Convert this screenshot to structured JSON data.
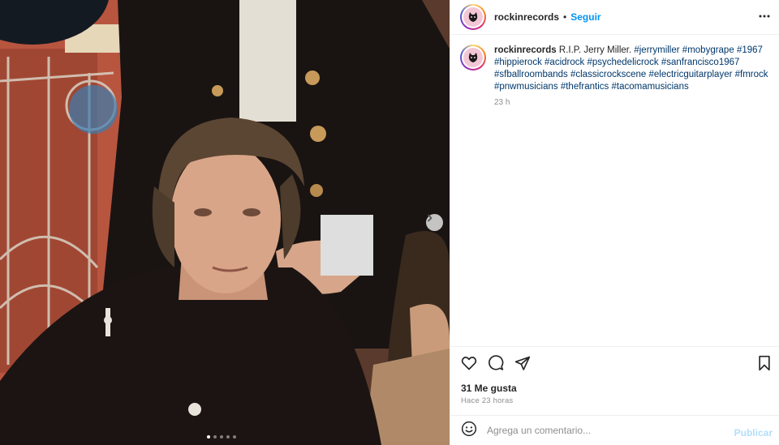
{
  "post": {
    "username": "rockinrecords",
    "follow_label": "Seguir",
    "separator": "•",
    "caption_text": "R.I.P. Jerry Miller.",
    "hashtags": [
      "#jerrymiller",
      "#mobygrape",
      "#1967",
      "#hippierock",
      "#acidrock",
      "#psychedelicrock",
      "#sanfrancisco1967",
      "#sfballroombands",
      "#classicrockscene",
      "#electricguitarplayer",
      "#fmrock",
      "#pnwmusicians",
      "#thefrantics",
      "#tacomamusicians"
    ],
    "caption_time": "23 h",
    "likes": "31 Me gusta",
    "posted_ago": "Hace 23 horas",
    "comment_placeholder": "Agrega un comentario...",
    "publish_label": "Publicar"
  },
  "carousel": {
    "total": 5,
    "current": 1
  },
  "icons": {
    "more": "more-options-icon",
    "like": "heart-icon",
    "comment": "comment-icon",
    "share": "share-icon",
    "save": "bookmark-icon",
    "emoji": "emoji-icon",
    "next": "chevron-right-icon"
  },
  "colors": {
    "link": "#0095f6",
    "hashtag": "#00376b",
    "muted": "#8e8e8e",
    "publish_disabled": "#b2dffc"
  }
}
